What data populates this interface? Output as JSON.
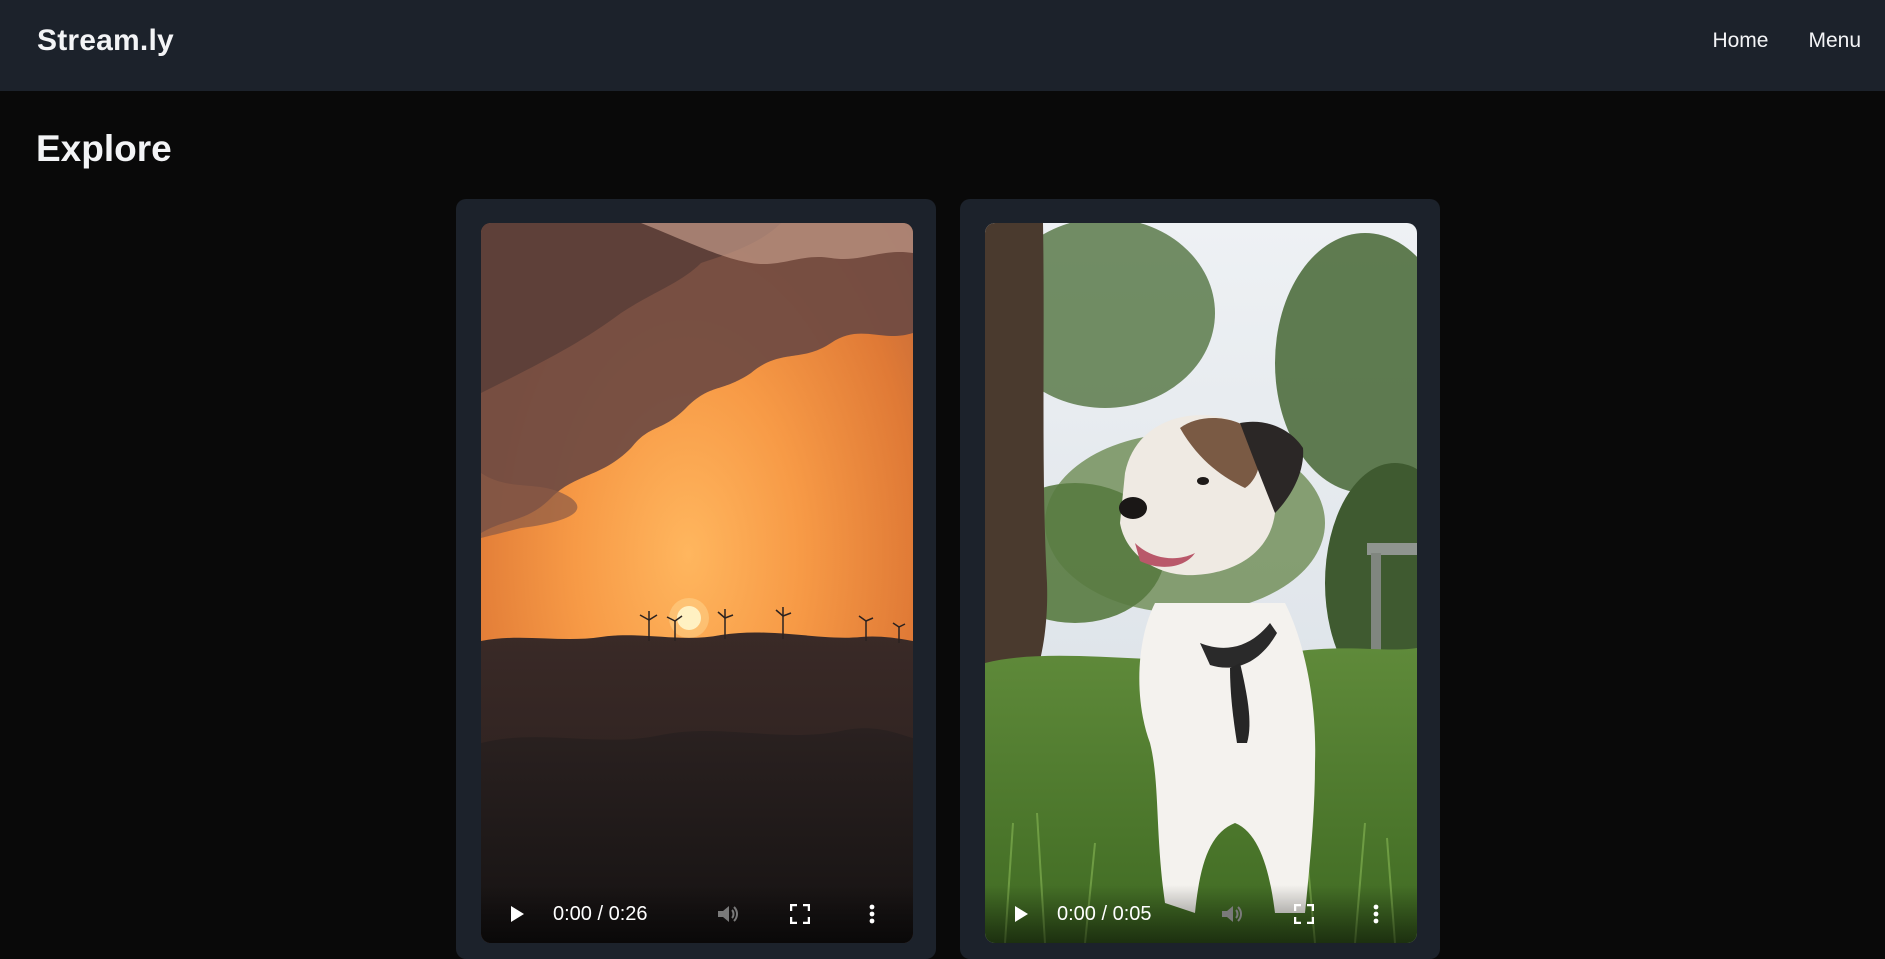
{
  "app": {
    "brand": "Stream.ly"
  },
  "nav": {
    "home": "Home",
    "menu": "Menu"
  },
  "page": {
    "heading": "Explore"
  },
  "videos": [
    {
      "scene": "sunset over hills with wind turbines",
      "time": "0:00 / 0:26",
      "icons": [
        "play-icon",
        "volume-icon",
        "fullscreen-icon",
        "more-options-icon"
      ]
    },
    {
      "scene": "white terrier dog standing in grass",
      "time": "0:00 / 0:05",
      "icons": [
        "play-icon",
        "volume-icon",
        "fullscreen-icon",
        "more-options-icon"
      ]
    }
  ],
  "colors": {
    "background": "#090909",
    "topbar": "#1c222b",
    "card": "#1c222b",
    "text": "#f3f4f6"
  }
}
